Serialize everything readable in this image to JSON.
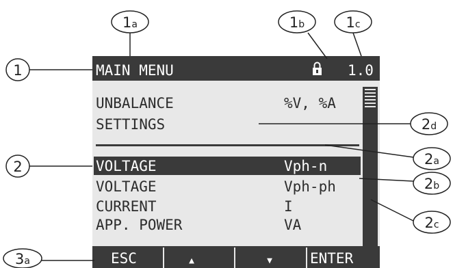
{
  "display": {
    "header": {
      "title": "MAIN MENU",
      "lock_icon": "padlock-icon",
      "version": "1.0"
    },
    "info": {
      "line1": "UNBALANCE",
      "line2": "SETTINGS",
      "units": "%V, %A"
    },
    "menu_items": [
      {
        "label": "VOLTAGE",
        "value": "Vph-n",
        "selected": true
      },
      {
        "label": "VOLTAGE",
        "value": "Vph-ph",
        "selected": false
      },
      {
        "label": "CURRENT",
        "value": "I",
        "selected": false
      },
      {
        "label": "APP. POWER",
        "value": "VA",
        "selected": false
      }
    ],
    "softkeys": [
      {
        "label": "ESC"
      },
      {
        "label": "▲",
        "icon": "up-arrow-icon"
      },
      {
        "label": "▼",
        "icon": "down-arrow-icon"
      },
      {
        "label": "ENTER"
      }
    ],
    "colors": {
      "screen_bg": "#e8e8e8",
      "dark": "#3a3a3a",
      "text": "#2c2c2c"
    }
  },
  "callouts": [
    {
      "id": "1",
      "main": "1",
      "sub": ""
    },
    {
      "id": "1a",
      "main": "1",
      "sub": "a"
    },
    {
      "id": "1b",
      "main": "1",
      "sub": "b"
    },
    {
      "id": "1c",
      "main": "1",
      "sub": "c"
    },
    {
      "id": "2",
      "main": "2",
      "sub": ""
    },
    {
      "id": "2a",
      "main": "2",
      "sub": "a"
    },
    {
      "id": "2b",
      "main": "2",
      "sub": "b"
    },
    {
      "id": "2c",
      "main": "2",
      "sub": "c"
    },
    {
      "id": "2d",
      "main": "2",
      "sub": "d"
    },
    {
      "id": "3a",
      "main": "3",
      "sub": "a"
    }
  ]
}
